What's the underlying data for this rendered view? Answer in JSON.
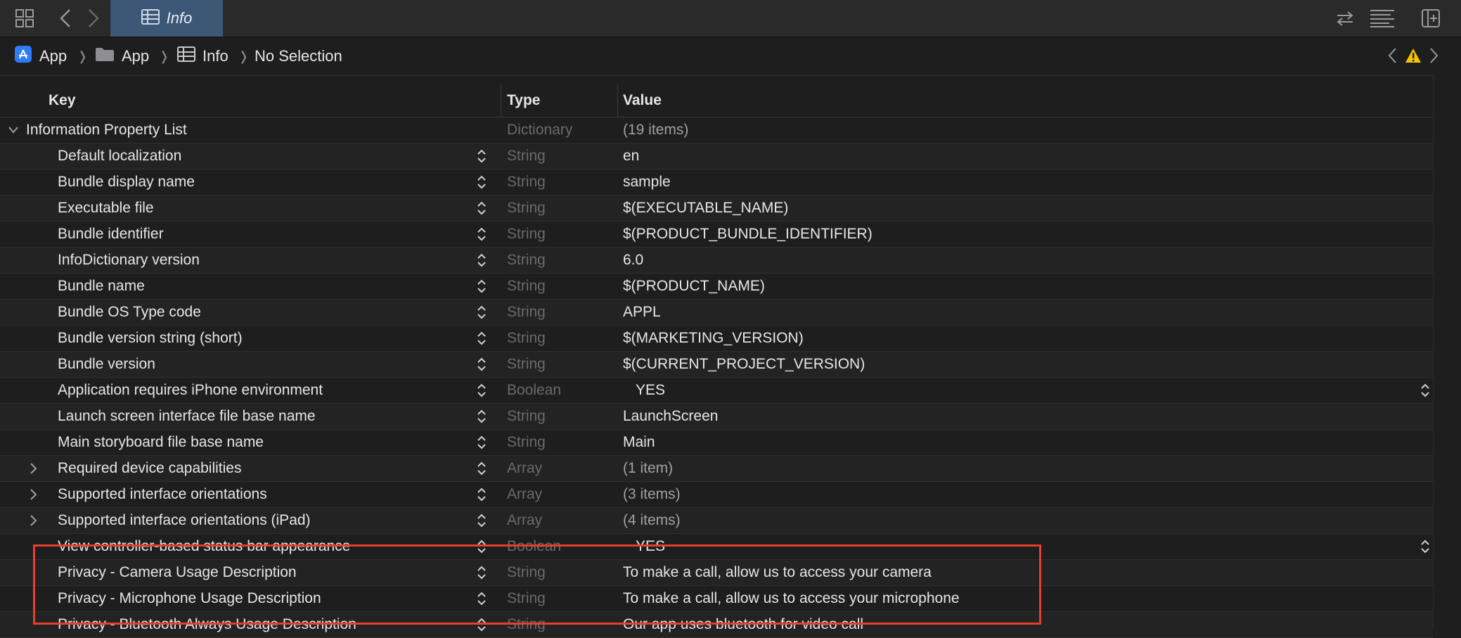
{
  "toolbar": {
    "tab_label": "Info",
    "icons": [
      "grid-icon",
      "back-icon",
      "forward-icon",
      "table-icon",
      "swap-icon",
      "lines-icon",
      "add-panel-icon"
    ]
  },
  "breadcrumb": {
    "items": [
      {
        "label": "App",
        "icon": "app-icon"
      },
      {
        "label": "App",
        "icon": "folder-icon"
      },
      {
        "label": "Info",
        "icon": "table-icon"
      },
      {
        "label": "No Selection"
      }
    ],
    "warning_color": "#f5c400"
  },
  "table": {
    "headers": {
      "key": "Key",
      "type": "Type",
      "value": "Value"
    },
    "root": {
      "key": "Information Property List",
      "type": "Dictionary",
      "value": "(19 items)"
    },
    "rows": [
      {
        "key": "Default localization",
        "type": "String",
        "value": "en"
      },
      {
        "key": "Bundle display name",
        "type": "String",
        "value": "sample"
      },
      {
        "key": "Executable file",
        "type": "String",
        "value": "$(EXECUTABLE_NAME)"
      },
      {
        "key": "Bundle identifier",
        "type": "String",
        "value": "$(PRODUCT_BUNDLE_IDENTIFIER)"
      },
      {
        "key": "InfoDictionary version",
        "type": "String",
        "value": "6.0"
      },
      {
        "key": "Bundle name",
        "type": "String",
        "value": "$(PRODUCT_NAME)"
      },
      {
        "key": "Bundle OS Type code",
        "type": "String",
        "value": "APPL"
      },
      {
        "key": "Bundle version string (short)",
        "type": "String",
        "value": "$(MARKETING_VERSION)"
      },
      {
        "key": "Bundle version",
        "type": "String",
        "value": "$(CURRENT_PROJECT_VERSION)"
      },
      {
        "key": "Application requires iPhone environment",
        "type": "Boolean",
        "value": "YES"
      },
      {
        "key": "Launch screen interface file base name",
        "type": "String",
        "value": "LaunchScreen"
      },
      {
        "key": "Main storyboard file base name",
        "type": "String",
        "value": "Main"
      },
      {
        "key": "Required device capabilities",
        "type": "Array",
        "value": "(1 item)"
      },
      {
        "key": "Supported interface orientations",
        "type": "Array",
        "value": "(3 items)"
      },
      {
        "key": "Supported interface orientations (iPad)",
        "type": "Array",
        "value": "(4 items)"
      },
      {
        "key": "View controller-based status bar appearance",
        "type": "Boolean",
        "value": "YES"
      },
      {
        "key": "Privacy - Camera Usage Description",
        "type": "String",
        "value": "To make a call, allow us to access your camera"
      },
      {
        "key": "Privacy - Microphone Usage Description",
        "type": "String",
        "value": "To make a call, allow us to access your microphone"
      },
      {
        "key": "Privacy - Bluetooth Always Usage Description",
        "type": "String",
        "value": "Our app uses bluetooth for video call"
      }
    ]
  },
  "colors": {
    "highlight": "#e4402d",
    "tab_bg": "#3d5777"
  }
}
